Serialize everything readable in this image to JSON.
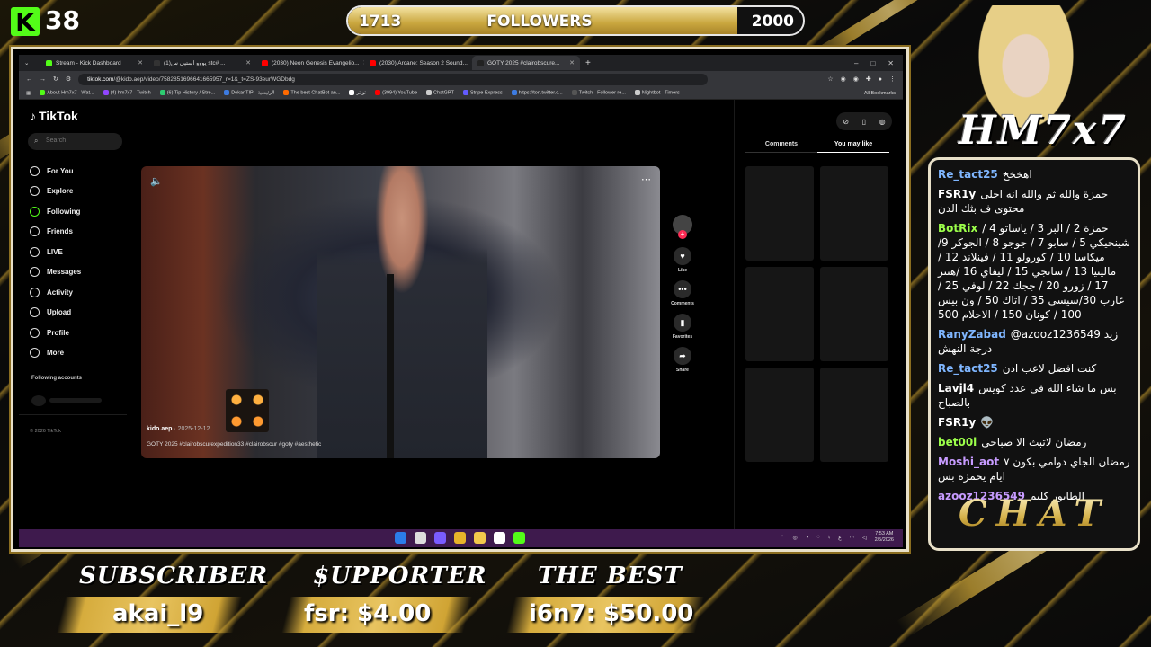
{
  "kick": {
    "logo_letter": "K",
    "count": "38"
  },
  "followers": {
    "current": "1713",
    "label": "FOLLOWERS",
    "goal": "2000",
    "progress_fraction": 0.856
  },
  "browser": {
    "tabs": [
      {
        "label": "Stream - Kick Dashboard",
        "color": "#53fc18",
        "active": false
      },
      {
        "label": "(1)يووو استيي س stc# ...",
        "color": "#333333",
        "active": false
      },
      {
        "label": "(2030) Neon Genesis Evangelio...",
        "color": "#ff0000",
        "active": false
      },
      {
        "label": "(2030) Arcane: Season 2 Sound...",
        "color": "#ff0000",
        "active": false
      },
      {
        "label": "GOTY 2025 #clairobscure...",
        "color": "#222222",
        "active": true
      }
    ],
    "window_controls": [
      "–",
      "□",
      "✕"
    ],
    "url_host": "tiktok.com",
    "url_path": "/@kido.aep/video/7582851696641665957_r=1&_t=ZS-93eurWGDbdg",
    "bookmarks": [
      {
        "label": "About Hm7x7 - Wat...",
        "color": "#53fc18"
      },
      {
        "label": "(4) hm7x7 - Twitch",
        "color": "#9146ff"
      },
      {
        "label": "(6) Tip History / Stre...",
        "color": "#2ecc71"
      },
      {
        "label": "DokanTIP - الرئيسية",
        "color": "#3d7be0"
      },
      {
        "label": "The best ChatBot an...",
        "color": "#ff6a00"
      },
      {
        "label": "تويتر",
        "color": "#ffffff"
      },
      {
        "label": "(3994) YouTube",
        "color": "#ff0000"
      },
      {
        "label": "ChatGPT",
        "color": "#cccccc"
      },
      {
        "label": "Stripe Express",
        "color": "#635bff"
      },
      {
        "label": "https://ton.twitter.c...",
        "color": "#3d7be0"
      },
      {
        "label": "Twitch - Follower re...",
        "color": "#555555"
      },
      {
        "label": "Nightbot - Timers",
        "color": "#cccccc"
      }
    ],
    "all_bookmarks": "All Bookmarks"
  },
  "tiktok": {
    "brand": "TikTok",
    "search_placeholder": "Search",
    "nav": [
      {
        "label": "For You",
        "icon": "home-icon"
      },
      {
        "label": "Explore",
        "icon": "compass-icon"
      },
      {
        "label": "Following",
        "icon": "following-icon"
      },
      {
        "label": "Friends",
        "icon": "friends-icon"
      },
      {
        "label": "LIVE",
        "icon": "live-icon"
      },
      {
        "label": "Messages",
        "icon": "messages-icon"
      },
      {
        "label": "Activity",
        "icon": "activity-icon"
      },
      {
        "label": "Upload",
        "icon": "upload-icon"
      },
      {
        "label": "Profile",
        "icon": "profile-icon"
      },
      {
        "label": "More",
        "icon": "more-icon"
      }
    ],
    "following_accounts": "Following accounts",
    "copyright": "© 2026 TikTok",
    "video": {
      "author": "kido.aep",
      "date": " · 2025-12-12",
      "caption": "GOTY 2025 #clairobscurexpedition33 #clairobscur #goty #aesthetic"
    },
    "actions": [
      {
        "label": "Like",
        "icon": "heart-icon",
        "glyph": "♥"
      },
      {
        "label": "Comments",
        "icon": "comment-icon",
        "glyph": "•••"
      },
      {
        "label": "Favorites",
        "icon": "bookmark-icon",
        "glyph": "▮"
      },
      {
        "label": "Share",
        "icon": "share-icon",
        "glyph": "➦"
      }
    ],
    "tabs": {
      "comments": "Comments",
      "you_may_like": "You may like"
    }
  },
  "taskbar": {
    "icon_colors": [
      "#2b7de9",
      "#dddddd",
      "#7a5cff",
      "#e8b32a",
      "#f2c94c",
      "#ffffff",
      "#53fc18"
    ],
    "time": "7:53 AM",
    "date": "2/5/2026",
    "lang": "ع"
  },
  "chat": {
    "logo": "HM7x7",
    "title": "CHAT",
    "messages": [
      {
        "user": "Re_tact25",
        "color": "#7fb6ff",
        "text": "اهخخخ"
      },
      {
        "user": "FSR1y",
        "color": "#ffffff",
        "text": "حمزة والله ثم والله انه احلى محتوى ف بثك الدن"
      },
      {
        "user": "BotRix",
        "color": "#9cff4a",
        "text": "حمزة 2 / البر 3 / ياساتو 4 / شينجيكي 5 / سابو 7 / جوجو 8 / الجوكر 9/ ميكاسا 10 / كورولو 11 / فينلاند 12 / مالينيا 13 / ساتجي 15 / ليفاي 16 /هنتر 17 / زورو 20 / ججك 22 / لوفي 25 / غارب 30/سيسي 35 / اتاك 50 / ون بيس 100 / كونان 150 / الاحلام 500"
      },
      {
        "user": "RanyZabad",
        "color": "#7fb6ff",
        "text": "@azooz1236549 زيد درجة النهش"
      },
      {
        "user": "Re_tact25",
        "color": "#7fb6ff",
        "text": "كنت افضل لاعب ادن"
      },
      {
        "user": "Lavjl4",
        "color": "#ffffff",
        "text": "بس ما شاء الله في عدد كويس بالصباح"
      },
      {
        "user": "FSR1y",
        "color": "#ffffff",
        "text": "👽"
      },
      {
        "user": "bet00l",
        "color": "#9cff4a",
        "text": "رمضان لاتبث الا صباحي"
      },
      {
        "user": "Moshi_aot",
        "color": "#c79bff",
        "text": "رمضان الجاي دوامي بكون ٧ ايام يحمزه بس"
      },
      {
        "user": "azooz1236549",
        "color": "#c79bff",
        "text": "الطابور كليم"
      }
    ]
  },
  "bottom": {
    "subscriber_label": "SUBSCRIBER",
    "subscriber_value": "akai_l9",
    "supporter_label": "$UPPORTER",
    "supporter_value": "fsr: $4.00",
    "best_label": "THE BEST",
    "best_value": "i6n7: $50.00"
  }
}
